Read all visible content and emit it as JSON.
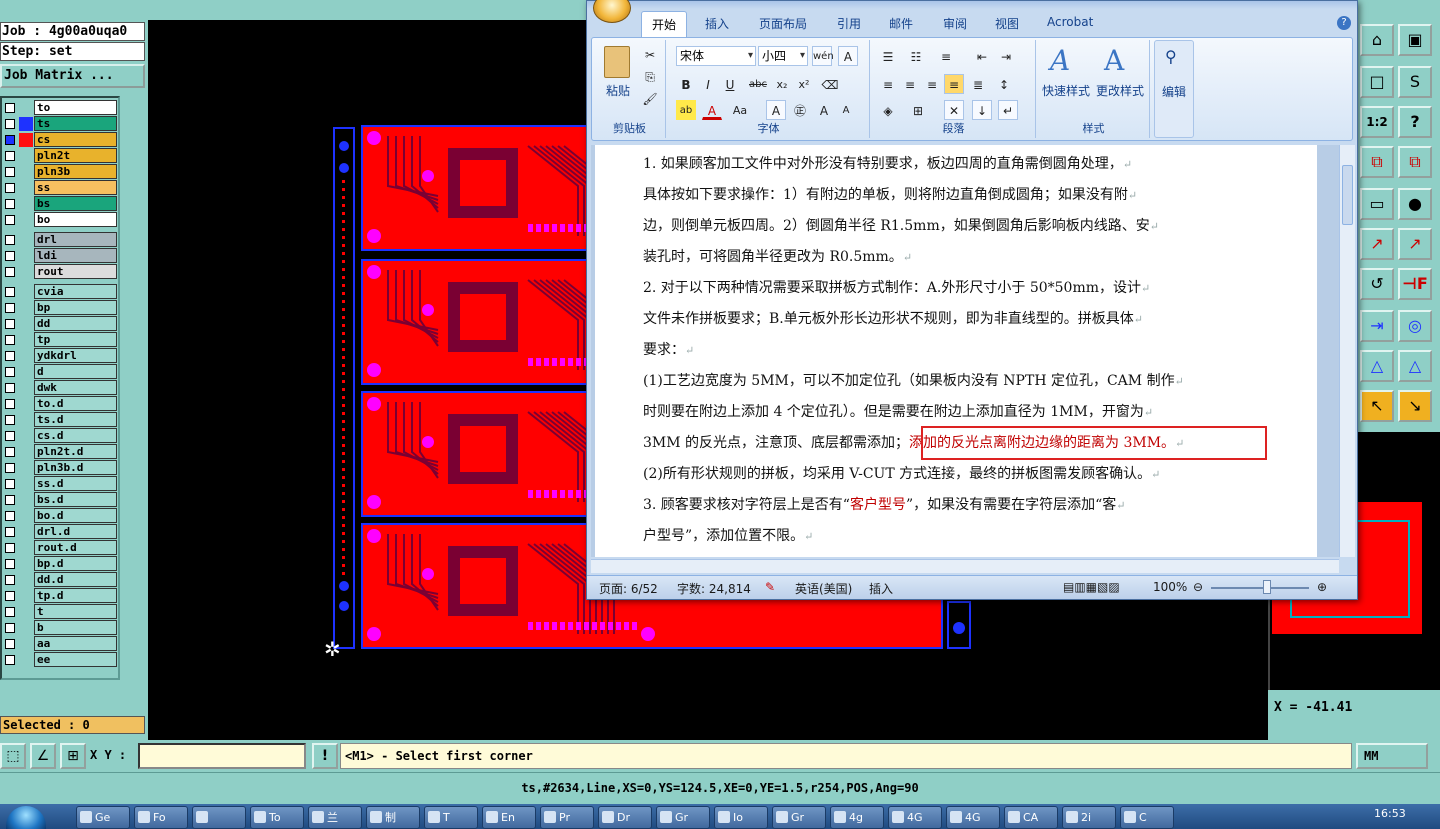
{
  "cam": {
    "job_label": "Job : 4g00a0uqa0",
    "step_label": "Step: set",
    "job_matrix_button": "Job Matrix ...",
    "layers": [
      {
        "name": "to",
        "bg": "#ffffff",
        "swatch": ""
      },
      {
        "name": "ts",
        "bg": "#1aa57c",
        "swatch": "#1e32ff"
      },
      {
        "name": "cs",
        "bg": "#e8b22c",
        "swatch": "#ff1010"
      },
      {
        "name": "pln2t",
        "bg": "#e8b22c",
        "swatch": ""
      },
      {
        "name": "pln3b",
        "bg": "#e8b22c",
        "swatch": ""
      },
      {
        "name": "ss",
        "bg": "#f7c060",
        "swatch": ""
      },
      {
        "name": "bs",
        "bg": "#1aa57c",
        "swatch": ""
      },
      {
        "name": "bo",
        "bg": "#ffffff",
        "swatch": ""
      },
      {
        "name": "drl",
        "bg": "#a7b6bd",
        "swatch": ""
      },
      {
        "name": "ldi",
        "bg": "#a7b6bd",
        "swatch": ""
      },
      {
        "name": "rout",
        "bg": "#dcdcdc",
        "swatch": ""
      },
      {
        "name": "cvia",
        "bg": "#9fd8d0",
        "swatch": ""
      },
      {
        "name": "bp",
        "bg": "#9fd8d0",
        "swatch": ""
      },
      {
        "name": "dd",
        "bg": "#9fd8d0",
        "swatch": ""
      },
      {
        "name": "tp",
        "bg": "#9fd8d0",
        "swatch": ""
      },
      {
        "name": "ydkdrl",
        "bg": "#9fd8d0",
        "swatch": ""
      },
      {
        "name": "d",
        "bg": "#9fd8d0",
        "swatch": ""
      },
      {
        "name": "dwk",
        "bg": "#9fd8d0",
        "swatch": ""
      },
      {
        "name": "to.d",
        "bg": "#9fd8d0",
        "swatch": ""
      },
      {
        "name": "ts.d",
        "bg": "#9fd8d0",
        "swatch": ""
      },
      {
        "name": "cs.d",
        "bg": "#9fd8d0",
        "swatch": ""
      },
      {
        "name": "pln2t.d",
        "bg": "#9fd8d0",
        "swatch": ""
      },
      {
        "name": "pln3b.d",
        "bg": "#9fd8d0",
        "swatch": ""
      },
      {
        "name": "ss.d",
        "bg": "#9fd8d0",
        "swatch": ""
      },
      {
        "name": "bs.d",
        "bg": "#9fd8d0",
        "swatch": ""
      },
      {
        "name": "bo.d",
        "bg": "#9fd8d0",
        "swatch": ""
      },
      {
        "name": "drl.d",
        "bg": "#9fd8d0",
        "swatch": ""
      },
      {
        "name": "rout.d",
        "bg": "#9fd8d0",
        "swatch": ""
      },
      {
        "name": "bp.d",
        "bg": "#9fd8d0",
        "swatch": ""
      },
      {
        "name": "dd.d",
        "bg": "#9fd8d0",
        "swatch": ""
      },
      {
        "name": "tp.d",
        "bg": "#9fd8d0",
        "swatch": ""
      },
      {
        "name": "t",
        "bg": "#9fd8d0",
        "swatch": ""
      },
      {
        "name": "b",
        "bg": "#9fd8d0",
        "swatch": ""
      },
      {
        "name": "aa",
        "bg": "#9fd8d0",
        "swatch": ""
      },
      {
        "name": "ee",
        "bg": "#9fd8d0",
        "swatch": ""
      }
    ],
    "selected_label": "Selected : 0",
    "xy_label": "X Y :",
    "xy_value": "",
    "command_message": "<M1> - Select first corner",
    "units": "MM",
    "coord_readout": "X = -41.41",
    "status_line": "ts,#2634,Line,XS=0,YS=124.5,XE=0,YE=1.5,r254,POS,Ang=90",
    "colors": {
      "pcb_red": "#ff0000",
      "pcb_pad": "#ff00ff",
      "pcb_trace": "#7a0033",
      "pcb_blue": "#1e32ff"
    }
  },
  "word": {
    "tabs": [
      "开始",
      "插入",
      "页面布局",
      "引用",
      "邮件",
      "审阅",
      "视图",
      "Acrobat"
    ],
    "active_tab": "开始",
    "groups": {
      "clipboard": "剪贴板",
      "font": "字体",
      "paragraph": "段落",
      "styles": "样式",
      "editing": "编辑"
    },
    "paste_label": "粘贴",
    "font_name": "宋体",
    "font_size": "小四",
    "quick_styles": "快速样式",
    "change_styles": "更改样式",
    "doc_lines": [
      {
        "text": "1. 如果顾客加工文件中对外形没有特别要求，板边四周的直角需倒圆角处理，",
        "red": ""
      },
      {
        "text": "具体按如下要求操作：1）有附边的单板，则将附边直角倒成圆角；如果没有附",
        "red": ""
      },
      {
        "text": "边，则倒单元板四周。2）倒圆角半径 R1.5mm，如果倒圆角后影响板内线路、安",
        "red": ""
      },
      {
        "text": "装孔时，可将圆角半径更改为 R0.5mm。",
        "red": ""
      },
      {
        "text": "2. 对于以下两种情况需要采取拼板方式制作：A.外形尺寸小于 50*50mm，设计",
        "red": ""
      },
      {
        "text": "文件未作拼板要求；B.单元板外形长边形状不规则，即为非直线型的。拼板具体",
        "red": ""
      },
      {
        "text": "要求：",
        "red": ""
      },
      {
        "text": "(1)工艺边宽度为 5MM，可以不加定位孔（如果板内没有 NPTH 定位孔，CAM 制作",
        "red": ""
      },
      {
        "text": "时则要在附边上添加 4 个定位孔）。但是需要在附边上添加直径为 1MM，开窗为",
        "red": ""
      },
      {
        "text": "3MM 的反光点，注意顶、底层都需添加；",
        "red": "添加的反光点离附边边缘的距离为 3MM。"
      },
      {
        "text": "(2)所有形状规则的拼板，均采用 V-CUT 方式连接，最终的拼板图需发顾客确认。",
        "red": ""
      },
      {
        "text": "3. 顾客要求核对字符层上是否有“",
        "red": "客户型号",
        "after": "”，如果没有需要在字符层添加“客"
      },
      {
        "text": "户型号”，添加位置不限。",
        "red": ""
      }
    ],
    "status": {
      "page": "页面: 6/52",
      "words": "字数: 24,814",
      "language": "英语(美国)",
      "mode": "插入",
      "zoom": "100%"
    }
  },
  "taskbar": {
    "items": [
      "Ge",
      "Fo",
      "",
      "To",
      "兰",
      "制",
      "T",
      "En",
      "Pr",
      "Dr",
      "Gr",
      "Io",
      "Gr",
      "4g",
      "4G",
      "4G",
      "CA",
      "2i",
      "C"
    ],
    "clock": "16:53"
  }
}
